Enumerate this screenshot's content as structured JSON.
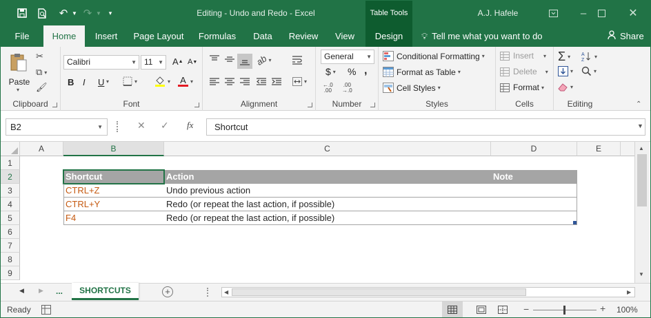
{
  "titlebar": {
    "document_title": "Editing - Undo and Redo  -  Excel",
    "contextual_tab": "Table Tools",
    "user": "A.J. Hafele"
  },
  "tabs": [
    "File",
    "Home",
    "Insert",
    "Page Layout",
    "Formulas",
    "Data",
    "Review",
    "View",
    "Design"
  ],
  "tell_me": "Tell me what you want to do",
  "share": "Share",
  "ribbon": {
    "clipboard": {
      "label": "Clipboard",
      "paste": "Paste"
    },
    "font": {
      "label": "Font",
      "name": "Calibri",
      "size": "11",
      "bold": "B",
      "italic": "I",
      "underline": "U"
    },
    "alignment": {
      "label": "Alignment"
    },
    "number": {
      "label": "Number",
      "format": "General",
      "currency": "$",
      "percent": "%",
      "comma": ","
    },
    "styles": {
      "label": "Styles",
      "conditional": "Conditional Formatting",
      "format_table": "Format as Table",
      "cell_styles": "Cell Styles"
    },
    "cells": {
      "label": "Cells",
      "insert": "Insert",
      "delete": "Delete",
      "format": "Format"
    },
    "editing": {
      "label": "Editing"
    }
  },
  "formula_bar": {
    "name_box": "B2",
    "fx": "fx",
    "content": "Shortcut"
  },
  "columns": [
    "A",
    "B",
    "C",
    "D",
    "E"
  ],
  "rows": [
    "1",
    "2",
    "3",
    "4",
    "5",
    "6",
    "7",
    "8",
    "9"
  ],
  "table": {
    "headers": [
      "Shortcut",
      "Action",
      "Note"
    ],
    "rows": [
      [
        "CTRL+Z",
        "Undo previous action",
        ""
      ],
      [
        "CTRL+Y",
        "Redo (or repeat the last action, if possible)",
        ""
      ],
      [
        "F4",
        "Redo (or repeat the last action, if possible)",
        ""
      ]
    ]
  },
  "sheets": {
    "ellipsis": "...",
    "active": "SHORTCUTS"
  },
  "status": {
    "ready": "Ready",
    "zoom": "100%"
  },
  "colors": {
    "brand": "#217346",
    "header_fill": "#a5a5a5",
    "shortcut_text": "#c55a11"
  }
}
